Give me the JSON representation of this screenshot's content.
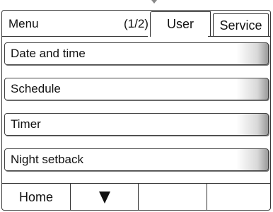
{
  "header": {
    "menu_label": "Menu",
    "page_indicator": "(1/2)",
    "tabs": [
      {
        "label": "User",
        "active": true
      },
      {
        "label": "Service",
        "active": false
      }
    ]
  },
  "menu_items": [
    {
      "label": "Date and time"
    },
    {
      "label": "Schedule"
    },
    {
      "label": "Timer"
    },
    {
      "label": "Night setback"
    }
  ],
  "bottom_bar": {
    "home_label": "Home",
    "next_page_icon": "down-arrow-icon"
  }
}
